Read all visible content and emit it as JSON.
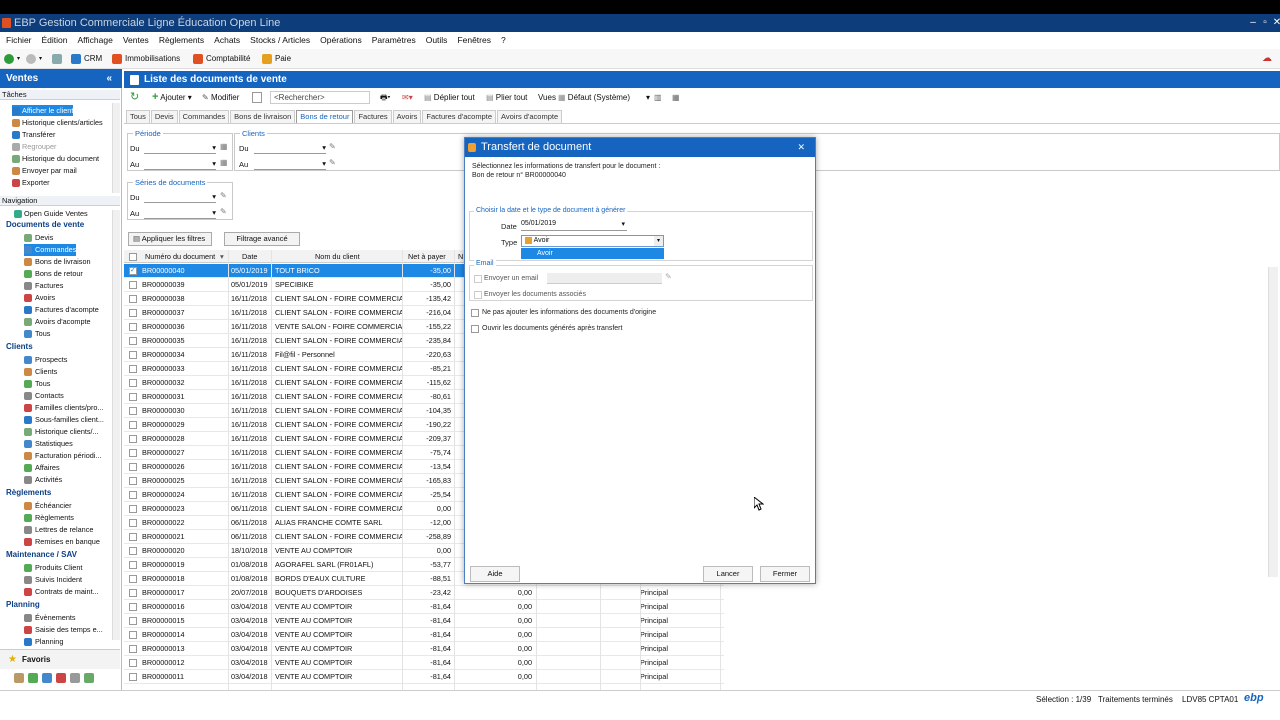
{
  "app": {
    "title": "EBP Gestion Commerciale Ligne Éducation Open Line"
  },
  "menu": [
    "Fichier",
    "Édition",
    "Affichage",
    "Ventes",
    "Règlements",
    "Achats",
    "Stocks / Articles",
    "Opérations",
    "Paramètres",
    "Outils",
    "Fenêtres",
    "?"
  ],
  "toolbar": {
    "crm": "CRM",
    "immobilisations": "Immobilisations",
    "comptabilite": "Comptabilité",
    "paie": "Paie"
  },
  "sidebar": {
    "header": "Ventes",
    "collapse": "«",
    "tasks_label": "Tâches",
    "tasks": [
      "Afficher le client",
      "Historique clients/articles",
      "Transférer",
      "Regrouper",
      "Historique du document",
      "Envoyer par mail",
      "Exporter"
    ],
    "nav_label": "Navigation",
    "open_guide": "Open Guide Ventes",
    "groups": [
      {
        "title": "Documents de vente",
        "items": [
          "Devis",
          "Commandes",
          "Bons de livraison",
          "Bons de retour",
          "Factures",
          "Avoirs",
          "Factures d'acompte",
          "Avoirs d'acompte",
          "Tous"
        ]
      },
      {
        "title": "Clients",
        "items": [
          "Prospects",
          "Clients",
          "Tous",
          "Contacts",
          "Familles clients/pro...",
          "Sous-familles client...",
          "Historique clients/...",
          "Statistiques",
          "Facturation périodi...",
          "Affaires",
          "Activités"
        ]
      },
      {
        "title": "Règlements",
        "items": [
          "Échéancier",
          "Règlements",
          "Lettres de relance",
          "Remises en banque"
        ]
      },
      {
        "title": "Maintenance / SAV",
        "items": [
          "Produits Client",
          "Suivis Incident",
          "Contrats de maint..."
        ]
      },
      {
        "title": "Planning",
        "items": [
          "Évènements",
          "Saisie des temps e...",
          "Planning"
        ]
      }
    ],
    "favoris": "Favoris"
  },
  "main": {
    "title": "Liste des documents de vente",
    "actions": {
      "ajouter": "Ajouter",
      "modifier": "Modifier",
      "search_placeholder": "<Rechercher>",
      "deplier": "Déplier tout",
      "plier": "Plier tout",
      "vues": "Vues",
      "defaut": "Défaut (Système)"
    },
    "tabs": [
      "Tous",
      "Devis",
      "Commandes",
      "Bons de livraison",
      "Bons de retour",
      "Factures",
      "Avoirs",
      "Factures d'acompte",
      "Avoirs d'acompte"
    ],
    "active_tab": "Bons de retour",
    "filters": {
      "periode": "Période",
      "clients": "Clients",
      "series": "Séries de documents",
      "du": "Du",
      "au": "Au",
      "apply": "Appliquer les filtres",
      "advanced": "Filtrage avancé"
    },
    "columns": [
      "Numéro du document",
      "Date",
      "Nom du client",
      "Net à payer",
      "N"
    ],
    "rows": [
      {
        "num": "BR00000040",
        "date": "05/01/2019",
        "client": "TOUT BRICO",
        "net": "-35,00",
        "selected": true
      },
      {
        "num": "BR00000039",
        "date": "05/01/2019",
        "client": "SPECIBIKE",
        "net": "-35,00"
      },
      {
        "num": "BR00000038",
        "date": "16/11/2018",
        "client": "CLIENT SALON - FOIRE COMMERCIALE",
        "net": "-135,42"
      },
      {
        "num": "BR00000037",
        "date": "16/11/2018",
        "client": "CLIENT SALON - FOIRE COMMERCIALE",
        "net": "-216,04"
      },
      {
        "num": "BR00000036",
        "date": "16/11/2018",
        "client": "VENTE SALON - FOIRE COMMERCIALE",
        "net": "-155,22"
      },
      {
        "num": "BR00000035",
        "date": "16/11/2018",
        "client": "CLIENT SALON - FOIRE COMMERCIALE",
        "net": "-235,84"
      },
      {
        "num": "BR00000034",
        "date": "16/11/2018",
        "client": "Fil@fil - Personnel",
        "net": "-220,63"
      },
      {
        "num": "BR00000033",
        "date": "16/11/2018",
        "client": "CLIENT SALON - FOIRE COMMERCIALE",
        "net": "-85,21"
      },
      {
        "num": "BR00000032",
        "date": "16/11/2018",
        "client": "CLIENT SALON - FOIRE COMMERCIALE",
        "net": "-115,62"
      },
      {
        "num": "BR00000031",
        "date": "16/11/2018",
        "client": "CLIENT SALON - FOIRE COMMERCIALE",
        "net": "-80,61"
      },
      {
        "num": "BR00000030",
        "date": "16/11/2018",
        "client": "CLIENT SALON - FOIRE COMMERCIALE",
        "net": "-104,35"
      },
      {
        "num": "BR00000029",
        "date": "16/11/2018",
        "client": "CLIENT SALON - FOIRE COMMERCIALE",
        "net": "-190,22"
      },
      {
        "num": "BR00000028",
        "date": "16/11/2018",
        "client": "CLIENT SALON - FOIRE COMMERCIALE",
        "net": "-209,37"
      },
      {
        "num": "BR00000027",
        "date": "16/11/2018",
        "client": "CLIENT SALON - FOIRE COMMERCIALE",
        "net": "-75,74"
      },
      {
        "num": "BR00000026",
        "date": "16/11/2018",
        "client": "CLIENT SALON - FOIRE COMMERCIALE",
        "net": "-13,54"
      },
      {
        "num": "BR00000025",
        "date": "16/11/2018",
        "client": "CLIENT SALON - FOIRE COMMERCIALE",
        "net": "-165,83"
      },
      {
        "num": "BR00000024",
        "date": "16/11/2018",
        "client": "CLIENT SALON - FOIRE COMMERCIALE",
        "net": "-25,54"
      },
      {
        "num": "BR00000023",
        "date": "06/11/2018",
        "client": "CLIENT SALON - FOIRE COMMERCIALE",
        "net": "0,00"
      },
      {
        "num": "BR00000022",
        "date": "06/11/2018",
        "client": "ALIAS FRANCHE COMTE SARL",
        "net": "-12,00"
      },
      {
        "num": "BR00000021",
        "date": "06/11/2018",
        "client": "CLIENT SALON - FOIRE COMMERCIALE",
        "net": "-258,89"
      },
      {
        "num": "BR00000020",
        "date": "18/10/2018",
        "client": "VENTE AU COMPTOIR",
        "net": "0,00"
      },
      {
        "num": "BR00000019",
        "date": "01/08/2018",
        "client": "AGORAFEL SARL (FR01AFL)",
        "net": "-53,77"
      },
      {
        "num": "BR00000018",
        "date": "01/08/2018",
        "client": "BORDS D'EAUX CULTURE",
        "net": "-88,51"
      },
      {
        "num": "BR00000017",
        "date": "20/07/2018",
        "client": "BOUQUETS D'ARDOISES",
        "net": "-23,42",
        "extra": "0,00",
        "depot": "Principal"
      },
      {
        "num": "BR00000016",
        "date": "03/04/2018",
        "client": "VENTE AU COMPTOIR",
        "net": "-81,64",
        "extra": "0,00",
        "depot": "Principal"
      },
      {
        "num": "BR00000015",
        "date": "03/04/2018",
        "client": "VENTE AU COMPTOIR",
        "net": "-81,64",
        "extra": "0,00",
        "depot": "Principal"
      },
      {
        "num": "BR00000014",
        "date": "03/04/2018",
        "client": "VENTE AU COMPTOIR",
        "net": "-81,64",
        "extra": "0,00",
        "depot": "Principal"
      },
      {
        "num": "BR00000013",
        "date": "03/04/2018",
        "client": "VENTE AU COMPTOIR",
        "net": "-81,64",
        "extra": "0,00",
        "depot": "Principal"
      },
      {
        "num": "BR00000012",
        "date": "03/04/2018",
        "client": "VENTE AU COMPTOIR",
        "net": "-81,64",
        "extra": "0,00",
        "depot": "Principal"
      },
      {
        "num": "BR00000011",
        "date": "03/04/2018",
        "client": "VENTE AU COMPTOIR",
        "net": "-81,64",
        "extra": "0,00",
        "depot": "Principal"
      }
    ]
  },
  "dialog": {
    "title": "Transfert de document",
    "intro": "Sélectionnez les informations de transfert pour le document :",
    "doc": "Bon de retour n° BR00000040",
    "section_date": "Choisir la date et le type de document à générer",
    "date_label": "Date",
    "date_value": "05/01/2019",
    "type_label": "Type",
    "type_value": "Avoir",
    "type_option": "Avoir",
    "email_section": "Email",
    "send_email": "Envoyer un email",
    "send_assoc": "Envoyer les documents associés",
    "no_origin": "Ne pas ajouter les informations des documents d'origine",
    "open_after": "Ouvrir les documents générés après transfert",
    "aide": "Aide",
    "lancer": "Lancer",
    "fermer": "Fermer"
  },
  "status": {
    "selection": "Sélection : 1/39",
    "traitements": "Traitements terminés",
    "codes": "LDV85  CPTA01",
    "brand": "ebp"
  }
}
